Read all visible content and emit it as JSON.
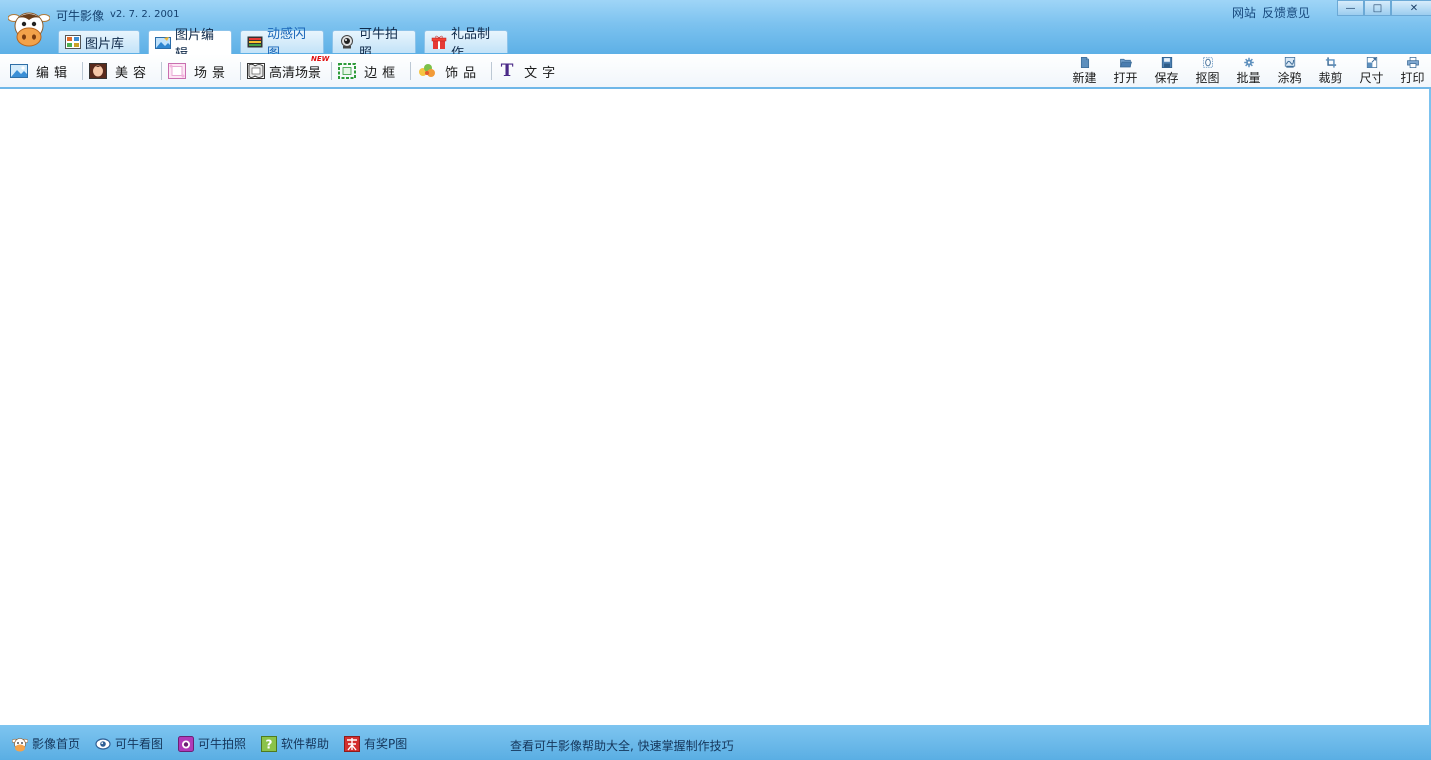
{
  "app": {
    "title": "可牛影像",
    "version": "v2. 7. 2. 2001"
  },
  "tabs": [
    {
      "label": "图片库",
      "icon": "grid-thumbnails-icon"
    },
    {
      "label": "图片编辑",
      "icon": "photo-edit-icon"
    },
    {
      "label": "动感闪图",
      "icon": "film-strip-icon"
    },
    {
      "label": "可牛拍照",
      "icon": "webcam-icon"
    },
    {
      "label": "礼品制作",
      "icon": "gift-icon"
    }
  ],
  "top_links": {
    "website": "网站",
    "feedback": "反馈意见"
  },
  "window_buttons": {
    "minimize": "—",
    "maximize": "□",
    "close": "✕"
  },
  "left_tools": [
    {
      "label": "编辑",
      "icon": "landscape-photo-icon"
    },
    {
      "label": "美容",
      "icon": "face-portrait-icon"
    },
    {
      "label": "场景",
      "icon": "scene-frame-icon"
    },
    {
      "label": "高清场景",
      "icon": "hd-scene-icon",
      "badge": "NEW"
    },
    {
      "label": "边框",
      "icon": "border-frame-icon"
    },
    {
      "label": "饰品",
      "icon": "clover-decoration-icon"
    },
    {
      "label": "文字",
      "icon": "text-t-icon"
    }
  ],
  "right_tools": [
    {
      "label": "新建",
      "icon": "new-file-icon"
    },
    {
      "label": "打开",
      "icon": "open-folder-icon"
    },
    {
      "label": "保存",
      "icon": "save-disk-icon"
    },
    {
      "label": "抠图",
      "icon": "cutout-icon"
    },
    {
      "label": "批量",
      "icon": "batch-gear-icon"
    },
    {
      "label": "涂鸦",
      "icon": "doodle-icon"
    },
    {
      "label": "裁剪",
      "icon": "crop-icon"
    },
    {
      "label": "尺寸",
      "icon": "resize-icon"
    },
    {
      "label": "打印",
      "icon": "printer-icon"
    }
  ],
  "status": {
    "items": [
      {
        "label": "影像首页",
        "icon": "cow-home-icon"
      },
      {
        "label": "可牛看图",
        "icon": "eye-viewer-icon"
      },
      {
        "label": "可牛拍照",
        "icon": "camera-icon"
      },
      {
        "label": "软件帮助",
        "icon": "help-question-icon"
      },
      {
        "label": "有奖P图",
        "icon": "prize-icon"
      }
    ],
    "tip": "查看可牛影像帮助大全, 快速掌握制作技巧"
  },
  "colors": {
    "titlebar": "#7cc2ef",
    "accent": "#5aaee3",
    "workspace": "#ffffff"
  }
}
